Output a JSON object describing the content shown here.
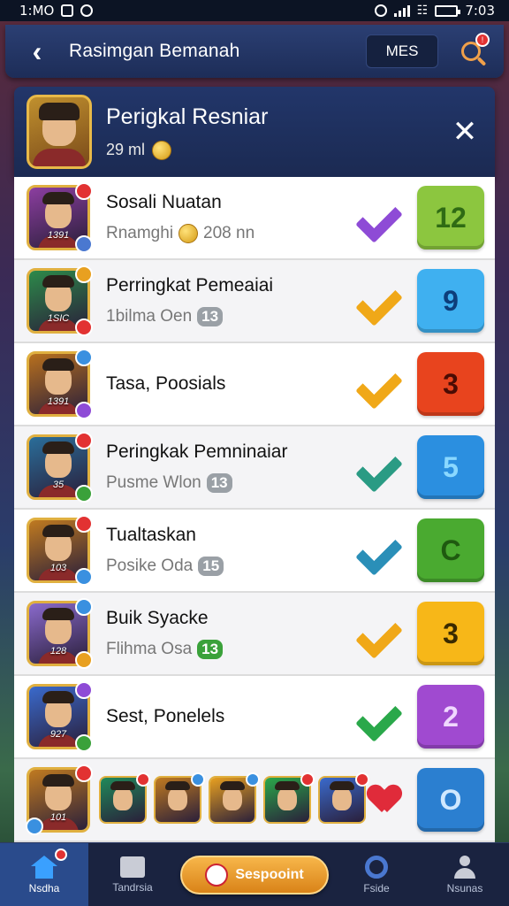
{
  "status_bar": {
    "time_left": "1:MO",
    "time_right": "7:03"
  },
  "header": {
    "title": "Rasimgan Bemanah",
    "mes_label": "MES",
    "search_badge": "!"
  },
  "player": {
    "name": "Perigkal Resniar",
    "sub": "29 ml"
  },
  "rows": [
    {
      "name": "Sosali Nuatan",
      "sub": "Rnamghi",
      "sub_extra": "208 nn",
      "pill": "",
      "rank": "12",
      "level": "1391",
      "check_color": "#8e4bd6",
      "box_color": "#8cc63f",
      "box_text_color": "#2f6b14",
      "avatar_bg": "#8c3ea0",
      "badges": [
        "#e23232",
        "#4a78d0"
      ]
    },
    {
      "name": "Perringkat Pemeaiai",
      "sub": "1bilma Oen",
      "sub_extra": "",
      "pill": "13",
      "rank": "9",
      "level": "1SIC",
      "check_color": "#f0a818",
      "box_color": "#3fb0f0",
      "box_text_color": "#0d3d7a",
      "avatar_bg": "#2d8a4a",
      "badges": [
        "#e8a020",
        "#e23232"
      ]
    },
    {
      "name": "Tasa, Poosials",
      "sub": "",
      "sub_extra": "",
      "pill": "",
      "rank": "3",
      "level": "1391",
      "check_color": "#f0a818",
      "box_color": "#e8441e",
      "box_text_color": "#4a0c04",
      "avatar_bg": "#b8701e",
      "badges": [
        "#3a90e0",
        "#8e4bd6"
      ]
    },
    {
      "name": "Peringkak Pemninaiar",
      "sub": "Pusme Wlon",
      "sub_extra": "",
      "pill": "13",
      "rank": "5",
      "level": "35",
      "check_color": "#2a9b84",
      "box_color": "#2b8fe0",
      "box_text_color": "#8ad8ff",
      "avatar_bg": "#2a6e9a",
      "badges": [
        "#e23232",
        "#3aa13a"
      ]
    },
    {
      "name": "Tualtaskan",
      "sub": "Posike Oda",
      "sub_extra": "",
      "pill": "15",
      "rank": "C",
      "level": "103",
      "check_color": "#2a8fb8",
      "box_color": "#4aaa30",
      "box_text_color": "#1f5a10",
      "avatar_bg": "#c07a20",
      "badges": [
        "#e23232",
        "#3a90e0"
      ]
    },
    {
      "name": "Buik Syacke",
      "sub": "Flihma Osa",
      "sub_extra": "",
      "pill": "13",
      "rank": "3",
      "level": "128",
      "check_color": "#f0a818",
      "box_color": "#f7b718",
      "box_text_color": "#3a2a00",
      "avatar_bg": "#8a6acc",
      "badges": [
        "#3a90e0",
        "#e8a020"
      ]
    },
    {
      "name": "Sest, Ponelels",
      "sub": "",
      "sub_extra": "",
      "pill": "",
      "rank": "2",
      "level": "927",
      "check_color": "#2aa84a",
      "box_color": "#a04ad0",
      "box_text_color": "#f0d8ff",
      "avatar_bg": "#3a6acc",
      "badges": [
        "#8e4bd6",
        "#3aa13a"
      ]
    }
  ],
  "last_row": {
    "level": "101",
    "rank": "O",
    "box_color": "#2b7fd0",
    "box_text_color": "#cfe8ff"
  },
  "bottom_nav": {
    "home_label": "Nsdha",
    "inbox_label": "Tandrsia",
    "center_label": "Sespooint",
    "ring_label": "Fside",
    "user_label": "Nsunas"
  }
}
